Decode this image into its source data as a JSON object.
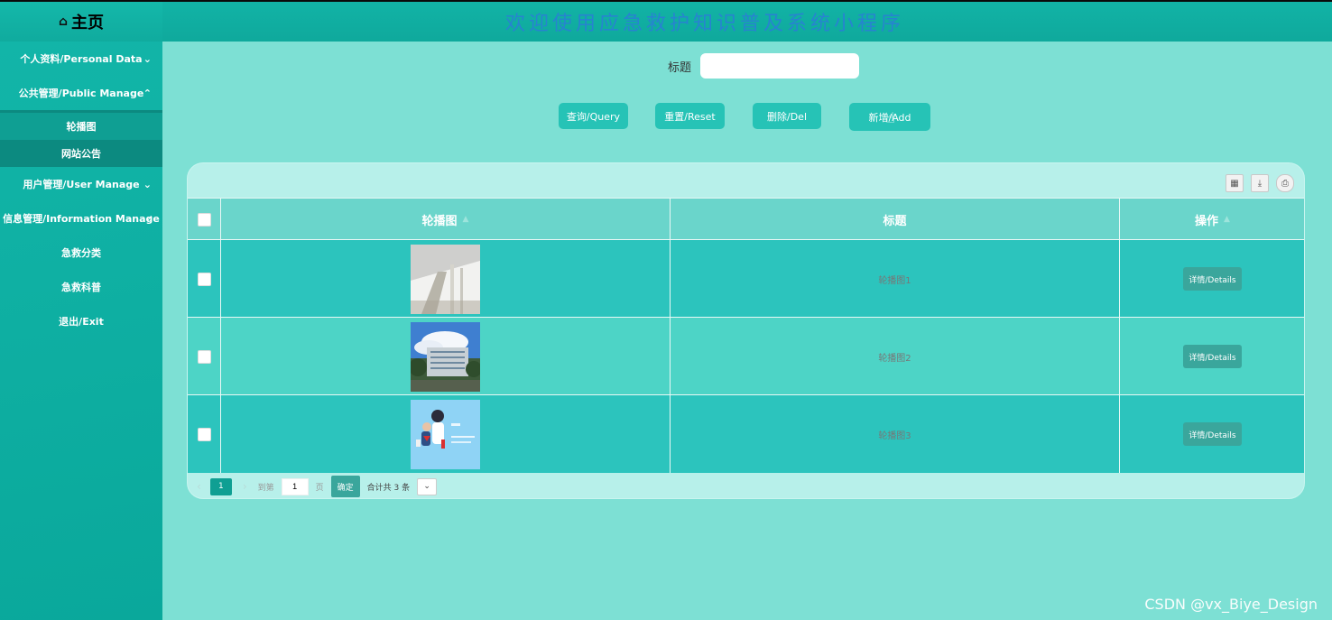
{
  "header": {
    "brand_icon": "home-icon",
    "brand_label": "主页",
    "system_title": "欢迎使用应急救护知识普及系统小程序"
  },
  "sidebar": {
    "items": [
      {
        "label": "个人资料/Personal Data",
        "chevron": "⌄"
      },
      {
        "label": "公共管理/Public Manage",
        "chevron": "⌃"
      },
      {
        "label": "用户管理/User Manage",
        "chevron": "⌄"
      },
      {
        "label": "信息管理/Information Manage",
        "chevron": "✓"
      },
      {
        "label": "急救分类"
      },
      {
        "label": "急救科普"
      },
      {
        "label": "退出/Exit"
      }
    ],
    "submenu": [
      {
        "label": "轮播图"
      },
      {
        "label": "网站公告"
      }
    ]
  },
  "search": {
    "label": "标题",
    "value": ""
  },
  "buttons": {
    "query": "查询/Query",
    "reset": "重置/Reset",
    "delete": "删除/Del",
    "add": "新增/Add"
  },
  "table": {
    "columns": [
      "轮播图",
      "标题",
      "操作"
    ],
    "rows": [
      {
        "title": "轮播图1",
        "action": "详情/Details",
        "image": "interior-photo"
      },
      {
        "title": "轮播图2",
        "action": "详情/Details",
        "image": "building-photo"
      },
      {
        "title": "轮播图3",
        "action": "详情/Details",
        "image": "medical-illustration"
      }
    ]
  },
  "pagination": {
    "current_page": "1",
    "goto_label": "到第",
    "page_input": "1",
    "page_unit": "页",
    "confirm": "确定",
    "total": "合计共 3 条"
  },
  "watermark": "CSDN @vx_Biye_Design",
  "colors": {
    "background": "#7de0d4",
    "sidebar": "#12b5a8",
    "button": "#26c3b6",
    "header_row": "#6ad5cb"
  }
}
